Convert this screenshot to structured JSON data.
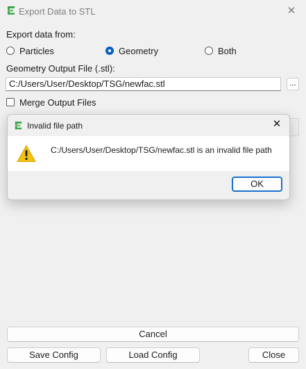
{
  "window": {
    "title": "Export Data to STL",
    "close_glyph": "✕"
  },
  "form": {
    "export_from_label": "Export data from:",
    "options": [
      {
        "label": "Particles",
        "checked": false
      },
      {
        "label": "Geometry",
        "checked": true
      },
      {
        "label": "Both",
        "checked": false
      }
    ],
    "output_file_label": "Geometry Output File (.stl):",
    "output_file_value": "C:/Users/User/Desktop/TSG/newfac.stl",
    "browse_label": "...",
    "merge_label": "Merge Output Files",
    "merge_checked": false
  },
  "buttons": {
    "cancel": "Cancel",
    "save_config": "Save Config",
    "load_config": "Load Config",
    "close": "Close"
  },
  "dialog": {
    "title": "Invalid file path",
    "message": "C:/Users/User/Desktop/TSG/newfac.stl is an invalid file path",
    "ok": "OK",
    "close_glyph": "✕",
    "icon": "warning-icon"
  },
  "colors": {
    "accent": "#0a5fc2",
    "warning": "#f4c20d",
    "app_icon": "#3fa34d"
  }
}
